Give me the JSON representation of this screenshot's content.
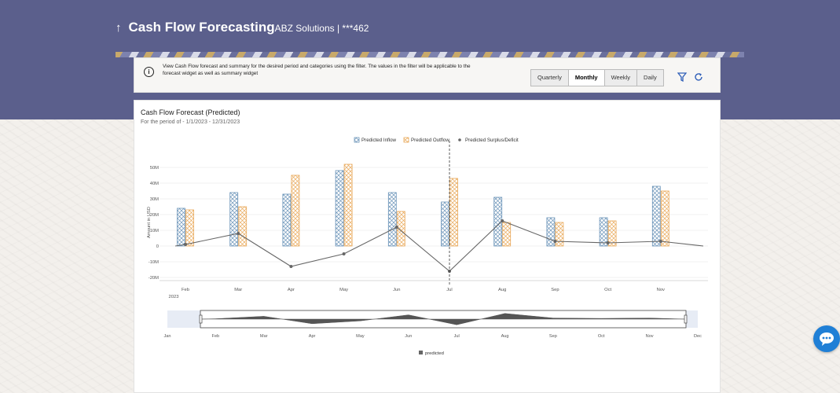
{
  "header": {
    "back_arrow": "↑",
    "title": "Cash Flow Forecasting",
    "subtitle": "ABZ Solutions | ***462"
  },
  "filter": {
    "info_text": "View Cash Flow forecast and summary for the desired period and categories using the filter. The values in the filter will be applicable to the forecast widget as well as summary widget",
    "periods": [
      "Quarterly",
      "Monthly",
      "Weekly",
      "Daily"
    ],
    "selected_period": "Monthly",
    "icons": [
      "filter-icon",
      "refresh-icon"
    ]
  },
  "chart_card": {
    "title": "Cash Flow Forecast (Predicted)",
    "period_label": "For the period of - 1/1/2023 - 12/31/2023"
  },
  "chart_data": {
    "type": "bar",
    "title": "Cash Flow Forecast (Predicted)",
    "categories": [
      "Feb",
      "Mar",
      "Apr",
      "May",
      "Jun",
      "Jul",
      "Aug",
      "Sep",
      "Oct",
      "Nov"
    ],
    "year_label": "2023",
    "ylabel": "Amount in USD",
    "ylim": [
      -20,
      55
    ],
    "yticks": [
      "50M",
      "40M",
      "30M",
      "20M",
      "10M",
      "0",
      "-10M",
      "-20M"
    ],
    "ytick_values": [
      50,
      40,
      30,
      20,
      10,
      0,
      -10,
      -20
    ],
    "legend_position": "top-center",
    "series": [
      {
        "name": "Predicted Inflow",
        "kind": "bar",
        "color": "#6a93b8",
        "values": [
          24,
          34,
          33,
          48,
          34,
          28,
          31,
          18,
          18,
          38
        ]
      },
      {
        "name": "Predicted Outflow",
        "kind": "bar",
        "color": "#e9a95a",
        "values": [
          23,
          25,
          45,
          52,
          22,
          43,
          15,
          15,
          16,
          35
        ]
      },
      {
        "name": "Predicted Surplus/Deficit",
        "kind": "line",
        "color": "#666666",
        "values": [
          1,
          8,
          -13,
          -5,
          12,
          -16,
          16,
          3,
          2,
          3
        ]
      }
    ],
    "line_extension": {
      "start_y": 0,
      "end_y": 0
    },
    "marker_category": "Jul",
    "navigator": {
      "months": [
        "Jan",
        "Feb",
        "Mar",
        "Apr",
        "May",
        "Jun",
        "Jul",
        "Aug",
        "Sep",
        "Oct",
        "Nov",
        "Dec"
      ],
      "legend": "predicted"
    }
  },
  "chat": {
    "icon": "chat-bubble-icon"
  }
}
